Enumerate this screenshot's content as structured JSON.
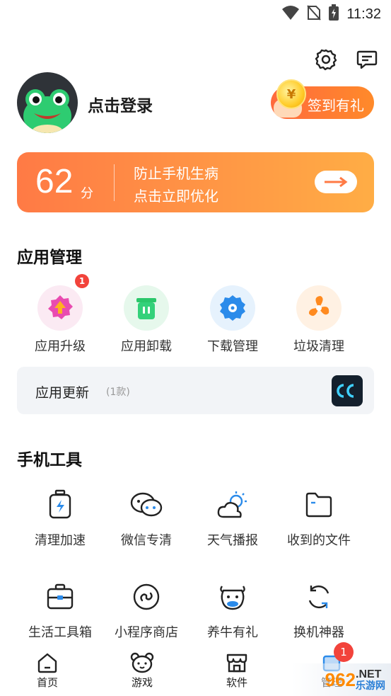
{
  "status_bar": {
    "time": "11:32",
    "icons": [
      "wifi-icon",
      "no-sim-icon",
      "battery-icon"
    ]
  },
  "top_actions": {
    "icons": [
      "settings-gear-icon",
      "message-icon"
    ]
  },
  "profile": {
    "login_label": "点击登录",
    "signin_label": "签到有礼",
    "coin_symbol": "¥"
  },
  "score_card": {
    "score": "62",
    "unit": "分",
    "line1": "防止手机生病",
    "line2": "点击立即优化"
  },
  "app_management": {
    "title": "应用管理",
    "items": [
      {
        "label": "应用升级",
        "icon": "app-upgrade-icon",
        "badge": "1"
      },
      {
        "label": "应用卸载",
        "icon": "app-uninstall-icon"
      },
      {
        "label": "下载管理",
        "icon": "download-manage-icon"
      },
      {
        "label": "垃圾清理",
        "icon": "junk-clean-fan-icon"
      }
    ]
  },
  "update_bar": {
    "title": "应用更新",
    "count": "(1款)"
  },
  "phone_tools": {
    "title": "手机工具",
    "row1": [
      {
        "label": "清理加速",
        "icon": "clean-boost-icon"
      },
      {
        "label": "微信专清",
        "icon": "wechat-clean-icon"
      },
      {
        "label": "天气播报",
        "icon": "weather-icon"
      },
      {
        "label": "收到的文件",
        "icon": "folder-icon"
      }
    ],
    "row2": [
      {
        "label": "生活工具箱",
        "icon": "toolbox-icon"
      },
      {
        "label": "小程序商店",
        "icon": "mini-program-icon"
      },
      {
        "label": "养牛有礼",
        "icon": "cow-icon"
      },
      {
        "label": "换机神器",
        "icon": "phone-switch-icon"
      }
    ]
  },
  "bottom_nav": {
    "items": [
      {
        "label": "首页",
        "icon": "home-icon"
      },
      {
        "label": "游戏",
        "icon": "game-bear-icon"
      },
      {
        "label": "软件",
        "icon": "software-store-icon"
      },
      {
        "label": "管理",
        "icon": "manage-icon",
        "badge": "1"
      }
    ]
  },
  "watermark": {
    "brand_number": "962",
    "brand_suffix": ".NET",
    "brand_text": "乐游网"
  },
  "colors": {
    "accent_orange": "#ff7a45",
    "badge_red": "#f2433b"
  }
}
